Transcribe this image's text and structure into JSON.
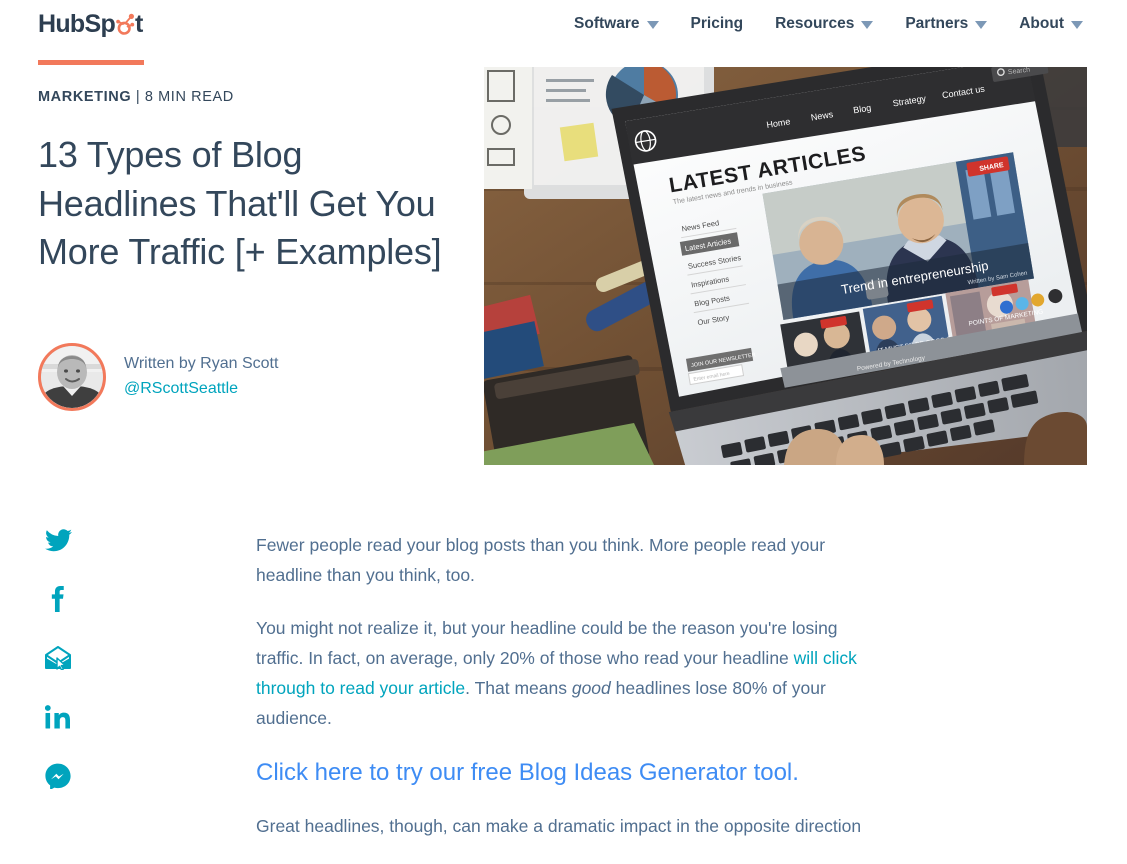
{
  "brand": {
    "logo_text_left": "HubSp",
    "logo_text_right": "t",
    "logo_name": "HubSpot",
    "accent_orange": "#f2795b",
    "accent_teal": "#00a4bd",
    "accent_blue": "#3e8cf4",
    "text_navy": "#33475b"
  },
  "nav": {
    "items": [
      {
        "label": "Software",
        "has_caret": true
      },
      {
        "label": "Pricing",
        "has_caret": false
      },
      {
        "label": "Resources",
        "has_caret": true
      },
      {
        "label": "Partners",
        "has_caret": true
      },
      {
        "label": "About",
        "has_caret": true
      }
    ]
  },
  "post": {
    "topic": "MARKETING",
    "read_time": "| 8 MIN READ",
    "title": "13 Types of Blog Headlines That'll Get You More Traffic [+ Examples]",
    "author": {
      "written_by": "Written by Ryan Scott",
      "handle": "@RScottSeattle"
    },
    "hero_image": {
      "alt": "Laptop on a wooden desk showing a blog homepage titled LATEST ARTICLES",
      "screen_heading": "LATEST ARTICLES",
      "screen_subheading": "The latest news and trends in business",
      "screen_nav": [
        "Home",
        "News",
        "Blog",
        "Strategy",
        "Contact us"
      ],
      "screen_search_placeholder": "Search",
      "screen_sidebar": [
        "News Feed",
        "Latest Articles",
        "Success Stories",
        "Inspirations",
        "Blog Posts",
        "Our Story"
      ],
      "screen_feature_caption": "Trend in entrepreneurship",
      "screen_share_label": "SHARE",
      "screen_footer": "Powered by Technology",
      "screen_newsletter": "JOIN OUR NEWSLETTER"
    }
  },
  "share": {
    "items": [
      {
        "name": "twitter-icon",
        "label": "Share on Twitter"
      },
      {
        "name": "facebook-icon",
        "label": "Share on Facebook"
      },
      {
        "name": "email-icon",
        "label": "Share by Email"
      },
      {
        "name": "linkedin-icon",
        "label": "Share on LinkedIn"
      },
      {
        "name": "messenger-icon",
        "label": "Share on Messenger"
      }
    ]
  },
  "body": {
    "p1": "Fewer people read your blog posts than you think. More people read your headline than you think, too.",
    "p2_a": "You might not realize it, but your headline could be the reason you're losing traffic. In fact, on average, only 20% of those who read your headline ",
    "p2_link": "will click through to read your article",
    "p2_b": ". That means ",
    "p2_em": "good",
    "p2_c": " headlines lose 80% of your audience.",
    "cta": "Click here to try our free Blog Ideas Generator tool.",
    "p3": "Great headlines, though, can make a dramatic impact in the opposite direction"
  }
}
